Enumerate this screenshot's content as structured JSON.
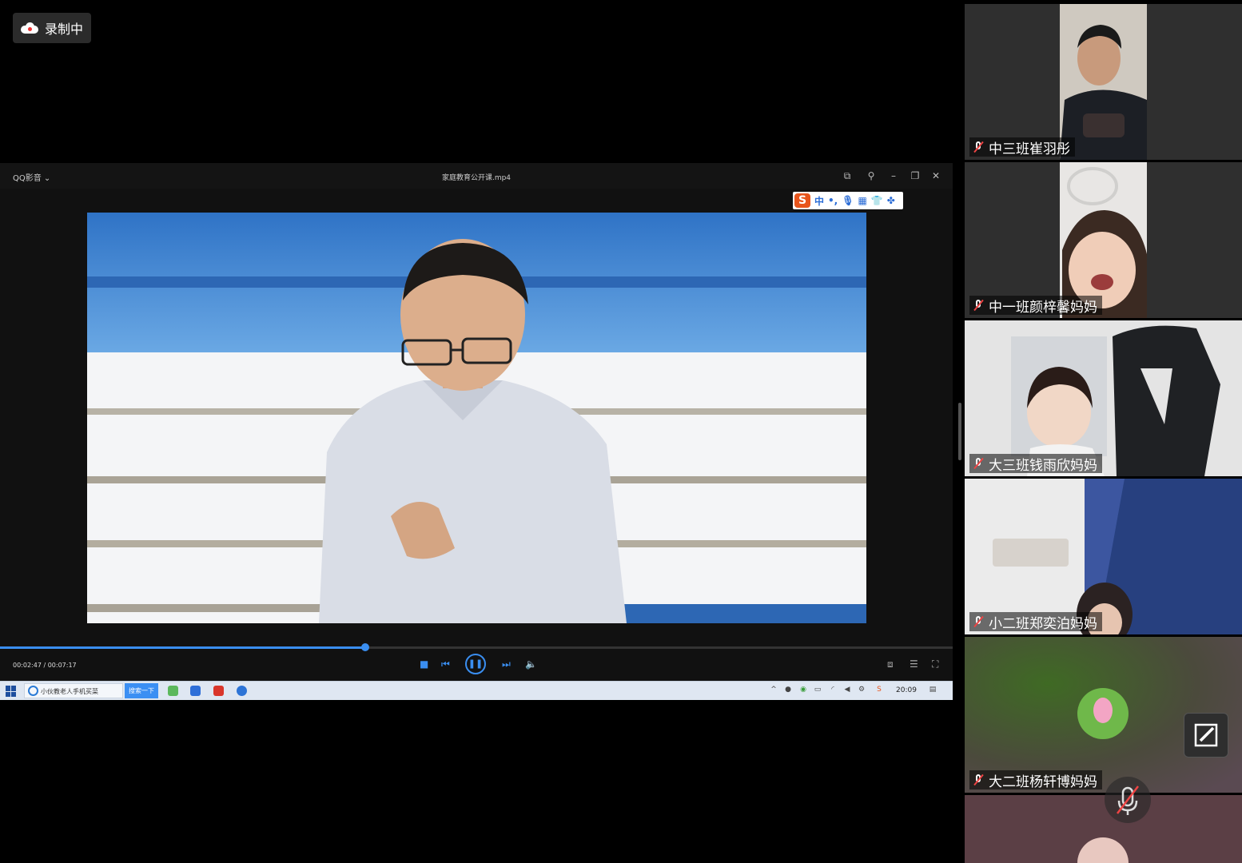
{
  "recording": {
    "label": "录制中"
  },
  "player": {
    "app_name": "QQ影音",
    "file_name": "家庭教育公开课.mp4",
    "current_time": "00:02:47",
    "total_time": "00:07:17",
    "time_display": "00:02:47 / 00:07:17",
    "progress_fraction": 0.383
  },
  "ime": {
    "mode_label": "中",
    "punct_label": "•,"
  },
  "taskbar": {
    "app_label": "小伙教老人手机买菜",
    "search_label": "搜索一下",
    "clock": "20:09"
  },
  "participants": [
    {
      "name": "中三班崔羽彤"
    },
    {
      "name": "中一班颜梓馨妈妈"
    },
    {
      "name": "大三班钱雨欣妈妈"
    },
    {
      "name": "小二班郑奕泊妈妈"
    },
    {
      "name": "大二班杨轩博妈妈"
    }
  ],
  "icons": {
    "record": "cloud-icon",
    "mic_muted": "mic-muted-icon",
    "edit": "edit-icon"
  },
  "colors": {
    "accent": "#3a8ef0",
    "muted_mic": "#e44444"
  }
}
